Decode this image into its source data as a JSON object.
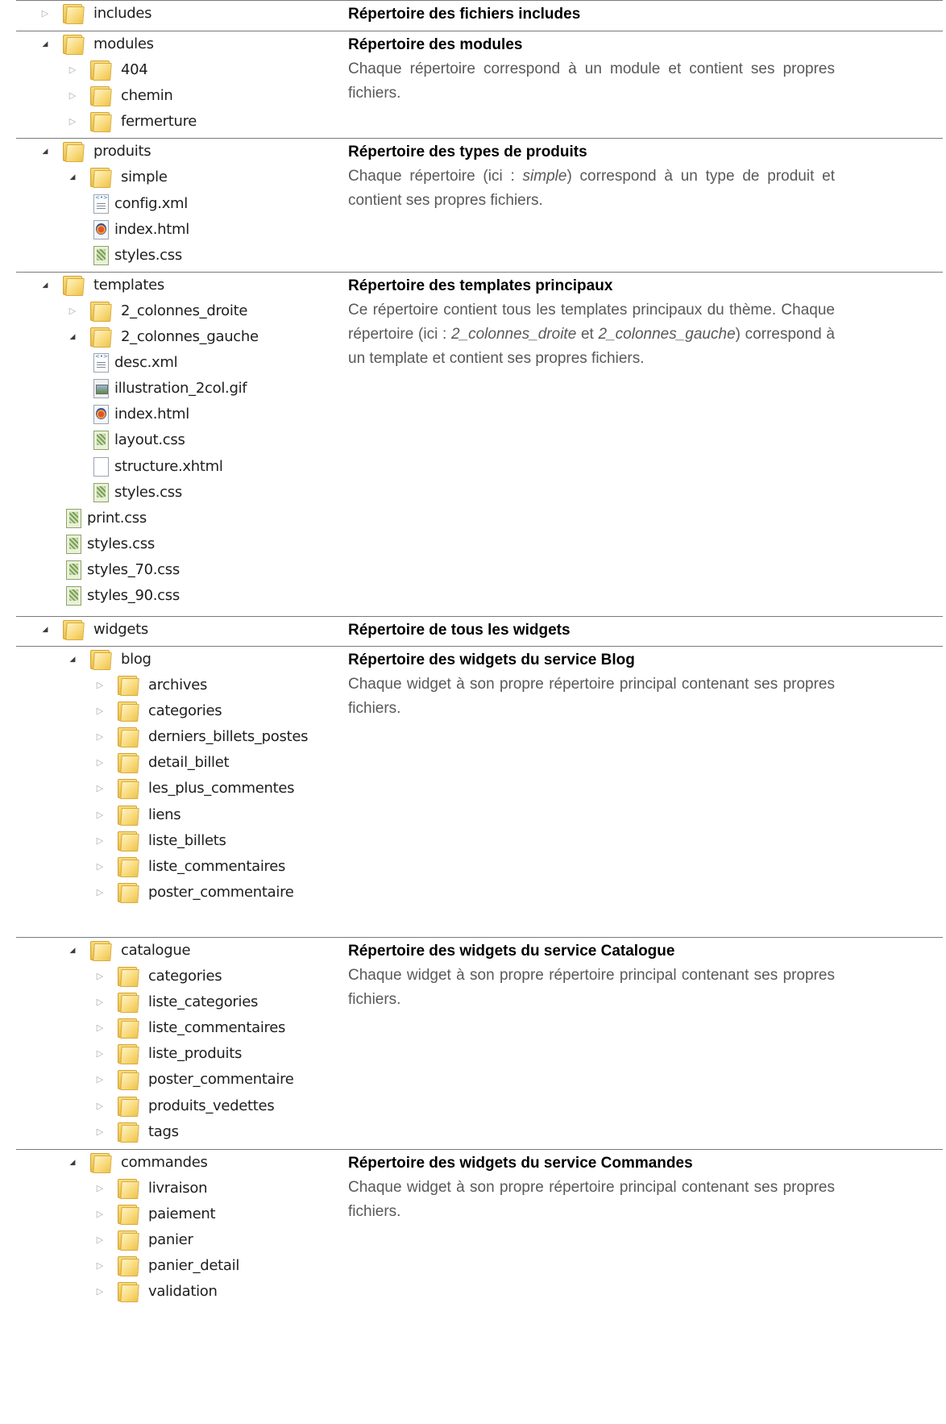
{
  "sections": [
    {
      "title": "Répertoire des fichiers includes",
      "body": "",
      "tree": [
        {
          "depth": 0,
          "type": "folder",
          "state": "collapsed",
          "name": "includes"
        }
      ]
    },
    {
      "title": "Répertoire des modules",
      "body": "Chaque répertoire correspond à un module et contient ses propres fichiers.",
      "tree": [
        {
          "depth": 0,
          "type": "folder",
          "state": "expanded",
          "name": "modules"
        },
        {
          "depth": 1,
          "type": "folder",
          "state": "collapsed",
          "name": "404"
        },
        {
          "depth": 1,
          "type": "folder",
          "state": "collapsed",
          "name": "chemin"
        },
        {
          "depth": 1,
          "type": "folder",
          "state": "collapsed",
          "name": "fermerture"
        }
      ]
    },
    {
      "title": "Répertoire des types de produits",
      "body_parts": [
        "Chaque répertoire (ici : ",
        "simple",
        ") correspond à un type de produit et contient ses propres fichiers."
      ],
      "tree": [
        {
          "depth": 0,
          "type": "folder",
          "state": "expanded",
          "name": "produits"
        },
        {
          "depth": 1,
          "type": "folder",
          "state": "expanded",
          "name": "simple"
        },
        {
          "depth": 2,
          "type": "file",
          "icon": "xml",
          "name": "config.xml"
        },
        {
          "depth": 2,
          "type": "file",
          "icon": "html",
          "name": "index.html"
        },
        {
          "depth": 2,
          "type": "file",
          "icon": "css",
          "name": "styles.css"
        }
      ]
    },
    {
      "title": "Répertoire des templates principaux",
      "body_parts": [
        "Ce répertoire contient tous les templates principaux du thème. Chaque répertoire (ici : ",
        "2_colonnes_droite",
        " et ",
        "2_colonnes_gauche",
        ") correspond à un template et contient ses propres fichiers."
      ],
      "tree": [
        {
          "depth": 0,
          "type": "folder",
          "state": "expanded",
          "name": "templates"
        },
        {
          "depth": 1,
          "type": "folder",
          "state": "collapsed",
          "name": "2_colonnes_droite"
        },
        {
          "depth": 1,
          "type": "folder",
          "state": "expanded",
          "name": "2_colonnes_gauche"
        },
        {
          "depth": 2,
          "type": "file",
          "icon": "xml",
          "name": "desc.xml"
        },
        {
          "depth": 2,
          "type": "file",
          "icon": "gif",
          "name": "illustration_2col.gif"
        },
        {
          "depth": 2,
          "type": "file",
          "icon": "html",
          "name": "index.html"
        },
        {
          "depth": 2,
          "type": "file",
          "icon": "css",
          "name": "layout.css"
        },
        {
          "depth": 2,
          "type": "file",
          "icon": "blank",
          "name": "structure.xhtml"
        },
        {
          "depth": 2,
          "type": "file",
          "icon": "css",
          "name": "styles.css"
        },
        {
          "depth": 1,
          "type": "file",
          "icon": "css",
          "name": "print.css"
        },
        {
          "depth": 1,
          "type": "file",
          "icon": "css",
          "name": "styles.css"
        },
        {
          "depth": 1,
          "type": "file",
          "icon": "css",
          "name": "styles_70.css"
        },
        {
          "depth": 1,
          "type": "file",
          "icon": "css",
          "name": "styles_90.css"
        }
      ]
    },
    {
      "title": "Répertoire de tous les widgets",
      "body": "",
      "tree": [
        {
          "depth": 0,
          "type": "folder",
          "state": "expanded",
          "name": "widgets"
        }
      ]
    },
    {
      "title": "Répertoire des widgets du service Blog",
      "body": "Chaque widget à son propre répertoire principal contenant ses propres fichiers.",
      "tree": [
        {
          "depth": 1,
          "type": "folder",
          "state": "expanded",
          "name": "blog"
        },
        {
          "depth": 2,
          "type": "folder",
          "state": "collapsed",
          "name": "archives"
        },
        {
          "depth": 2,
          "type": "folder",
          "state": "collapsed",
          "name": "categories"
        },
        {
          "depth": 2,
          "type": "folder",
          "state": "collapsed",
          "name": "derniers_billets_postes"
        },
        {
          "depth": 2,
          "type": "folder",
          "state": "collapsed",
          "name": "detail_billet"
        },
        {
          "depth": 2,
          "type": "folder",
          "state": "collapsed",
          "name": "les_plus_commentes"
        },
        {
          "depth": 2,
          "type": "folder",
          "state": "collapsed",
          "name": "liens"
        },
        {
          "depth": 2,
          "type": "folder",
          "state": "collapsed",
          "name": "liste_billets"
        },
        {
          "depth": 2,
          "type": "folder",
          "state": "collapsed",
          "name": "liste_commentaires"
        },
        {
          "depth": 2,
          "type": "folder",
          "state": "collapsed",
          "name": "poster_commentaire"
        }
      ]
    },
    {
      "title": "Répertoire des widgets du service Catalogue",
      "body": "Chaque widget à son propre répertoire principal contenant ses propres fichiers.",
      "tree": [
        {
          "depth": 1,
          "type": "folder",
          "state": "expanded",
          "name": "catalogue"
        },
        {
          "depth": 2,
          "type": "folder",
          "state": "collapsed",
          "name": "categories"
        },
        {
          "depth": 2,
          "type": "folder",
          "state": "collapsed",
          "name": "liste_categories"
        },
        {
          "depth": 2,
          "type": "folder",
          "state": "collapsed",
          "name": "liste_commentaires"
        },
        {
          "depth": 2,
          "type": "folder",
          "state": "collapsed",
          "name": "liste_produits"
        },
        {
          "depth": 2,
          "type": "folder",
          "state": "collapsed",
          "name": "poster_commentaire"
        },
        {
          "depth": 2,
          "type": "folder",
          "state": "collapsed",
          "name": "produits_vedettes"
        },
        {
          "depth": 2,
          "type": "folder",
          "state": "collapsed",
          "name": "tags"
        }
      ]
    },
    {
      "title": "Répertoire des widgets du service Commandes",
      "body": "Chaque widget à son propre répertoire principal contenant ses propres fichiers.",
      "tree": [
        {
          "depth": 1,
          "type": "folder",
          "state": "expanded",
          "name": "commandes"
        },
        {
          "depth": 2,
          "type": "folder",
          "state": "collapsed",
          "name": "livraison"
        },
        {
          "depth": 2,
          "type": "folder",
          "state": "collapsed",
          "name": "paiement"
        },
        {
          "depth": 2,
          "type": "folder",
          "state": "collapsed",
          "name": "panier"
        },
        {
          "depth": 2,
          "type": "folder",
          "state": "collapsed",
          "name": "panier_detail"
        },
        {
          "depth": 2,
          "type": "folder",
          "state": "collapsed",
          "name": "validation"
        }
      ]
    }
  ],
  "icons": {
    "expanded": "expanded-arrow-icon",
    "collapsed": "collapsed-arrow-icon",
    "folder": "folder-icon",
    "xml": "xml-file-icon",
    "html": "html-file-icon",
    "css": "css-file-icon",
    "gif": "gif-image-file-icon",
    "blank": "blank-file-icon"
  },
  "colors": {
    "folder": "#f4cf62",
    "divider": "#7a7a7a",
    "title": "#000000",
    "body": "#595959"
  }
}
